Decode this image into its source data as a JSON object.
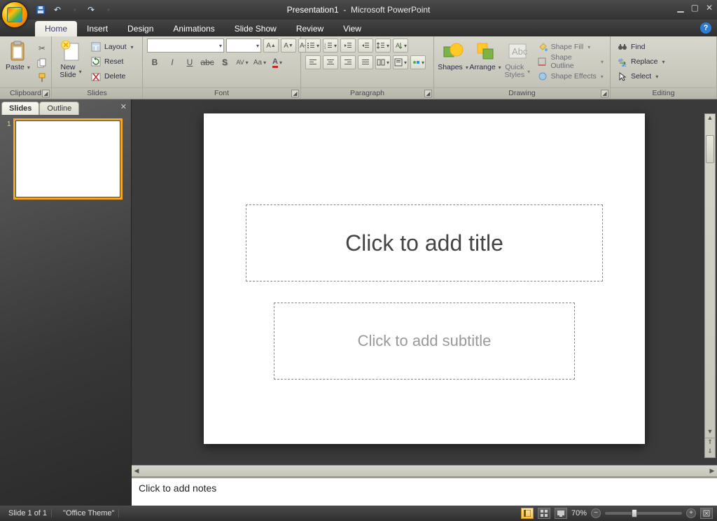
{
  "title": {
    "document": "Presentation1",
    "app": "Microsoft PowerPoint"
  },
  "tabs": [
    "Home",
    "Insert",
    "Design",
    "Animations",
    "Slide Show",
    "Review",
    "View"
  ],
  "active_tab": "Home",
  "ribbon": {
    "clipboard": {
      "label": "Clipboard",
      "paste": "Paste"
    },
    "slides": {
      "label": "Slides",
      "new_slide": "New\nSlide",
      "layout": "Layout",
      "reset": "Reset",
      "delete": "Delete"
    },
    "font": {
      "label": "Font"
    },
    "paragraph": {
      "label": "Paragraph"
    },
    "drawing": {
      "label": "Drawing",
      "shapes": "Shapes",
      "arrange": "Arrange",
      "quick_styles": "Quick\nStyles",
      "shape_fill": "Shape Fill",
      "shape_outline": "Shape Outline",
      "shape_effects": "Shape Effects"
    },
    "editing": {
      "label": "Editing",
      "find": "Find",
      "replace": "Replace",
      "select": "Select"
    }
  },
  "left_pane": {
    "tabs": [
      "Slides",
      "Outline"
    ],
    "active": "Slides",
    "slide_number": "1"
  },
  "slide": {
    "title_placeholder": "Click to add title",
    "subtitle_placeholder": "Click to add subtitle"
  },
  "notes": {
    "placeholder": "Click to add notes"
  },
  "status": {
    "slide": "Slide 1 of 1",
    "theme": "\"Office Theme\"",
    "zoom": "70%"
  }
}
